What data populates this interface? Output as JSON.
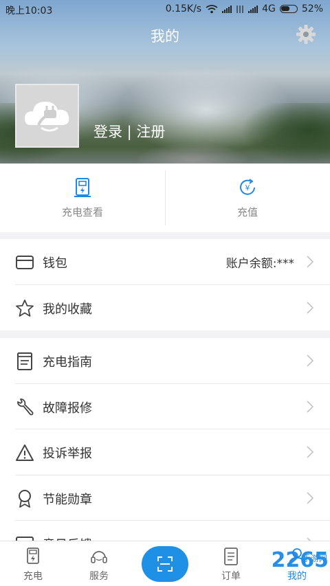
{
  "status_bar": {
    "time": "晚上10:03",
    "speed": "0.15K/s",
    "network": "4G",
    "battery": "52%"
  },
  "header": {
    "title": "我的",
    "login_text": "登录 | 注册",
    "settings_icon": "gear-icon"
  },
  "quick_actions": [
    {
      "label": "充电查看",
      "icon": "charger-icon"
    },
    {
      "label": "充值",
      "icon": "yen-refresh-icon"
    }
  ],
  "group1": [
    {
      "label": "钱包",
      "value": "账户余额:***",
      "icon": "wallet-icon"
    },
    {
      "label": "我的收藏",
      "icon": "star-icon"
    }
  ],
  "group2": [
    {
      "label": "充电指南",
      "icon": "guide-book-icon"
    },
    {
      "label": "故障报修",
      "icon": "wrench-icon"
    },
    {
      "label": "投诉举报",
      "icon": "warning-icon"
    },
    {
      "label": "节能勋章",
      "icon": "medal-icon"
    },
    {
      "label": "意见反馈",
      "icon": "feedback-icon"
    }
  ],
  "bottom_nav": [
    {
      "label": "充电",
      "icon": "charger-icon"
    },
    {
      "label": "服务",
      "icon": "headset-icon"
    },
    {
      "label": "",
      "icon": "scan-icon"
    },
    {
      "label": "订单",
      "icon": "order-icon"
    },
    {
      "label": "我的",
      "icon": "person-icon"
    }
  ],
  "watermark": {
    "main": "2265",
    "sub": "手游网"
  },
  "colors": {
    "accent": "#1e88e5",
    "text": "#333333",
    "muted": "#888888"
  }
}
